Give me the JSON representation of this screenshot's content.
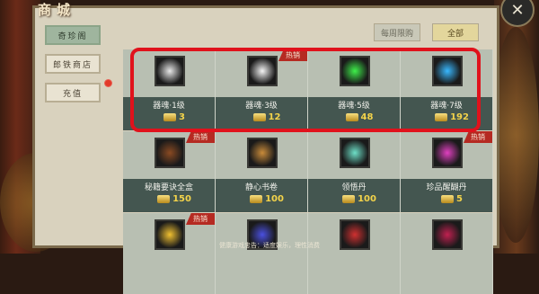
{
  "window": {
    "title": "商城",
    "close_icon": "close-icon"
  },
  "sidebar": {
    "items": [
      {
        "label": "奇珍阁",
        "active": true
      },
      {
        "label": "郎铁商店",
        "active": false
      },
      {
        "label": "充值",
        "active": false,
        "has_badge": true
      }
    ]
  },
  "tabs": [
    {
      "label": "每周限购",
      "active": false
    },
    {
      "label": "全部",
      "active": true
    }
  ],
  "items": [
    {
      "name": "器魂·1级",
      "price": "3",
      "hot": false,
      "icon": "white-soul-flame-icon",
      "color": "#e8e8e8"
    },
    {
      "name": "器魂·3级",
      "price": "12",
      "hot": true,
      "hot_label": "热销",
      "icon": "white-soul-orb-icon",
      "color": "#f5f5f5"
    },
    {
      "name": "器魂·5级",
      "price": "48",
      "hot": false,
      "icon": "green-soul-flame-icon",
      "color": "#3ef04a"
    },
    {
      "name": "器魂·7级",
      "price": "192",
      "hot": false,
      "icon": "blue-soul-flame-icon",
      "color": "#38b8ff"
    },
    {
      "name": "秘籍要诀全盒",
      "price": "150",
      "hot": true,
      "hot_label": "热销",
      "icon": "treasure-chest-icon",
      "color": "#8a4a22"
    },
    {
      "name": "静心书卷",
      "price": "100",
      "hot": false,
      "icon": "scroll-icon",
      "color": "#c98b3a"
    },
    {
      "name": "领悟丹",
      "price": "100",
      "hot": false,
      "icon": "jade-pill-icon",
      "color": "#6ee0c8"
    },
    {
      "name": "珍品醒醐丹",
      "price": "5",
      "hot": true,
      "hot_label": "热销",
      "icon": "purple-orb-icon",
      "color": "#e040c0"
    },
    {
      "name": "",
      "price": "",
      "hot": true,
      "hot_label": "热销",
      "icon": "gold-trophy-icon",
      "color": "#f0c030"
    },
    {
      "name": "",
      "price": "",
      "hot": false,
      "icon": "purple-gem-icon",
      "color": "#4a50e0"
    },
    {
      "name": "",
      "price": "",
      "hot": false,
      "icon": "red-item-icon",
      "color": "#d03030"
    },
    {
      "name": "",
      "price": "",
      "hot": false,
      "icon": "red-potion-icon",
      "color": "#c02050"
    }
  ],
  "footer": "健康游戏忠告：适度娱乐，理性消费"
}
